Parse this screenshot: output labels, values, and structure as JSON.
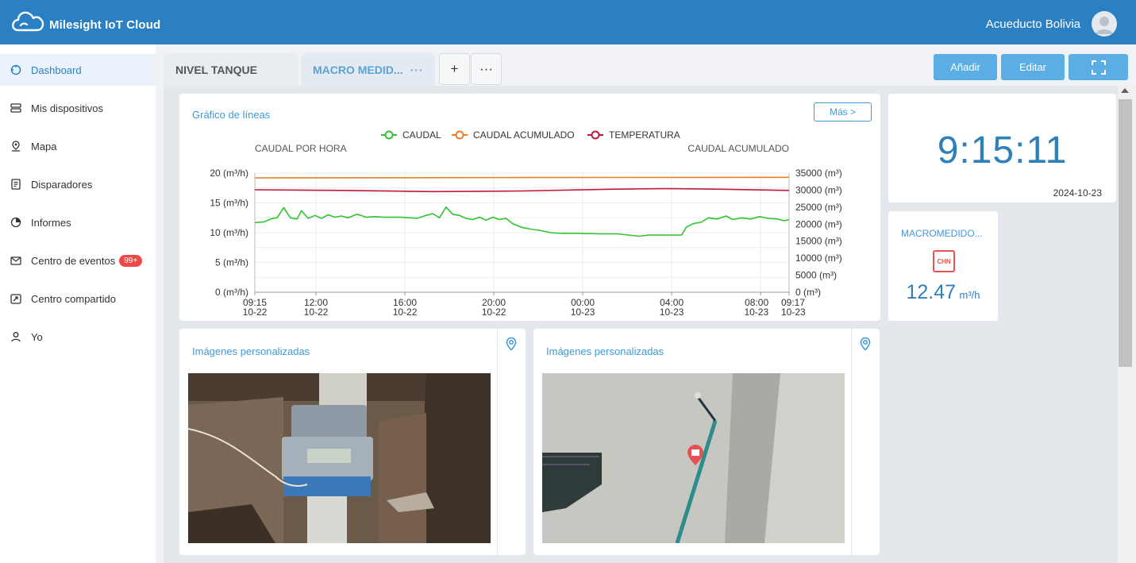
{
  "app": {
    "title": "Milesight IoT Cloud",
    "user": "Acueducto Bolivia"
  },
  "sidebar": {
    "items": [
      {
        "label": "Dashboard",
        "icon": "dashboard-icon",
        "active": true
      },
      {
        "label": "Mis dispositivos",
        "icon": "devices-icon"
      },
      {
        "label": "Mapa",
        "icon": "map-icon"
      },
      {
        "label": "Disparadores",
        "icon": "triggers-icon"
      },
      {
        "label": "Informes",
        "icon": "reports-icon"
      },
      {
        "label": "Centro de eventos",
        "icon": "events-icon",
        "badge": "99+"
      },
      {
        "label": "Centro compartido",
        "icon": "share-icon"
      },
      {
        "label": "Yo",
        "icon": "user-icon"
      }
    ]
  },
  "tabs": [
    {
      "label": "NIVEL TANQUE",
      "active": false
    },
    {
      "label": "MACRO MEDID...",
      "active": true,
      "more": "···"
    }
  ],
  "tab_actions": {
    "add": "+",
    "more": "···"
  },
  "toolbar": {
    "add_label": "Añadir",
    "edit_label": "Editar"
  },
  "line_chart": {
    "title": "Gráfico de líneas",
    "more_label": "Más >"
  },
  "clock": {
    "time": "9:15:11",
    "date": "2024-10-23"
  },
  "meter": {
    "title": "MACROMEDIDO...",
    "logo_text": "CHN",
    "value": "12.47",
    "unit": "m³/h"
  },
  "images": [
    {
      "title": "Imágenes personalizadas"
    },
    {
      "title": "Imágenes personalizadas"
    }
  ],
  "colors": {
    "header": "#2b80c4",
    "caudal": "#2fc42f",
    "caudal_acumulado": "#e67e22",
    "temperatura": "#c0183a",
    "accent": "#3d9ad9"
  },
  "chart_data": {
    "type": "line",
    "legend": [
      "CAUDAL",
      "CAUDAL ACUMULADO",
      "TEMPERATURA"
    ],
    "left_axis_title": "CAUDAL POR HORA",
    "right_axis_title": "CAUDAL ACUMULADO",
    "left_ticks": [
      "0 (m³/h)",
      "5 (m³/h)",
      "10 (m³/h)",
      "15 (m³/h)",
      "20 (m³/h)"
    ],
    "right_ticks": [
      "0 (m³)",
      "5000 (m³)",
      "10000 (m³)",
      "15000 (m³)",
      "20000 (m³)",
      "25000 (m³)",
      "30000 (m³)",
      "35000 (m³)"
    ],
    "ylim_left": [
      0,
      20
    ],
    "ylim_right": [
      0,
      35000
    ],
    "x_ticks": [
      {
        "time": "09:15",
        "date": "10-22",
        "h": 0
      },
      {
        "time": "12:00",
        "date": "10-22",
        "h": 2.75
      },
      {
        "time": "16:00",
        "date": "10-22",
        "h": 6.75
      },
      {
        "time": "20:00",
        "date": "10-22",
        "h": 10.75
      },
      {
        "time": "00:00",
        "date": "10-23",
        "h": 14.75
      },
      {
        "time": "04:00",
        "date": "10-23",
        "h": 18.75
      },
      {
        "time": "08:00",
        "date": "10-23",
        "h": 22.75
      },
      {
        "time": "09:17",
        "date": "10-23",
        "h": 24.03
      }
    ],
    "x_span_hours": 24.03,
    "series": [
      {
        "name": "CAUDAL",
        "axis": "left",
        "points": [
          [
            0,
            11.7
          ],
          [
            0.4,
            11.8
          ],
          [
            0.8,
            12.4
          ],
          [
            1.0,
            12.5
          ],
          [
            1.3,
            14.2
          ],
          [
            1.6,
            12.5
          ],
          [
            1.9,
            12.3
          ],
          [
            2.1,
            13.7
          ],
          [
            2.4,
            12.4
          ],
          [
            2.7,
            12.9
          ],
          [
            3.0,
            12.4
          ],
          [
            3.3,
            13.0
          ],
          [
            3.6,
            12.6
          ],
          [
            3.9,
            12.8
          ],
          [
            4.2,
            12.5
          ],
          [
            4.6,
            13.1
          ],
          [
            5.0,
            12.6
          ],
          [
            5.4,
            12.7
          ],
          [
            5.8,
            12.6
          ],
          [
            6.2,
            12.6
          ],
          [
            6.6,
            12.6
          ],
          [
            7.0,
            12.5
          ],
          [
            7.3,
            12.4
          ],
          [
            7.7,
            12.9
          ],
          [
            8.0,
            13.2
          ],
          [
            8.3,
            12.5
          ],
          [
            8.6,
            14.3
          ],
          [
            8.9,
            13.1
          ],
          [
            9.2,
            12.9
          ],
          [
            9.5,
            12.4
          ],
          [
            9.8,
            12.2
          ],
          [
            10.1,
            12.6
          ],
          [
            10.4,
            12.1
          ],
          [
            10.7,
            12.6
          ],
          [
            11.0,
            12.2
          ],
          [
            11.3,
            12.4
          ],
          [
            11.6,
            11.5
          ],
          [
            12.0,
            10.9
          ],
          [
            12.4,
            10.6
          ],
          [
            12.8,
            10.4
          ],
          [
            13.3,
            10.0
          ],
          [
            13.8,
            9.9
          ],
          [
            14.5,
            9.9
          ],
          [
            15.5,
            9.8
          ],
          [
            16.3,
            9.8
          ],
          [
            16.8,
            9.6
          ],
          [
            17.3,
            9.4
          ],
          [
            17.7,
            9.6
          ],
          [
            18.2,
            9.6
          ],
          [
            18.7,
            9.6
          ],
          [
            19.2,
            9.6
          ],
          [
            19.4,
            10.9
          ],
          [
            19.7,
            11.5
          ],
          [
            20.1,
            11.8
          ],
          [
            20.4,
            12.5
          ],
          [
            20.8,
            12.3
          ],
          [
            21.2,
            12.8
          ],
          [
            21.5,
            12.2
          ],
          [
            21.9,
            12.5
          ],
          [
            22.3,
            12.3
          ],
          [
            22.7,
            12.7
          ],
          [
            23.1,
            12.4
          ],
          [
            23.5,
            12.3
          ],
          [
            23.8,
            12.0
          ],
          [
            24.03,
            12.2
          ]
        ]
      },
      {
        "name": "CAUDAL ACUMULADO",
        "axis": "left",
        "points": [
          [
            0,
            19.2
          ],
          [
            12,
            19.25
          ],
          [
            24.03,
            19.3
          ]
        ]
      },
      {
        "name": "TEMPERATURA",
        "axis": "left",
        "points": [
          [
            0,
            17.2
          ],
          [
            4,
            17.1
          ],
          [
            8,
            16.9
          ],
          [
            12,
            17.0
          ],
          [
            16,
            17.3
          ],
          [
            18.5,
            17.4
          ],
          [
            21,
            17.3
          ],
          [
            24.03,
            17.1
          ]
        ]
      }
    ]
  }
}
